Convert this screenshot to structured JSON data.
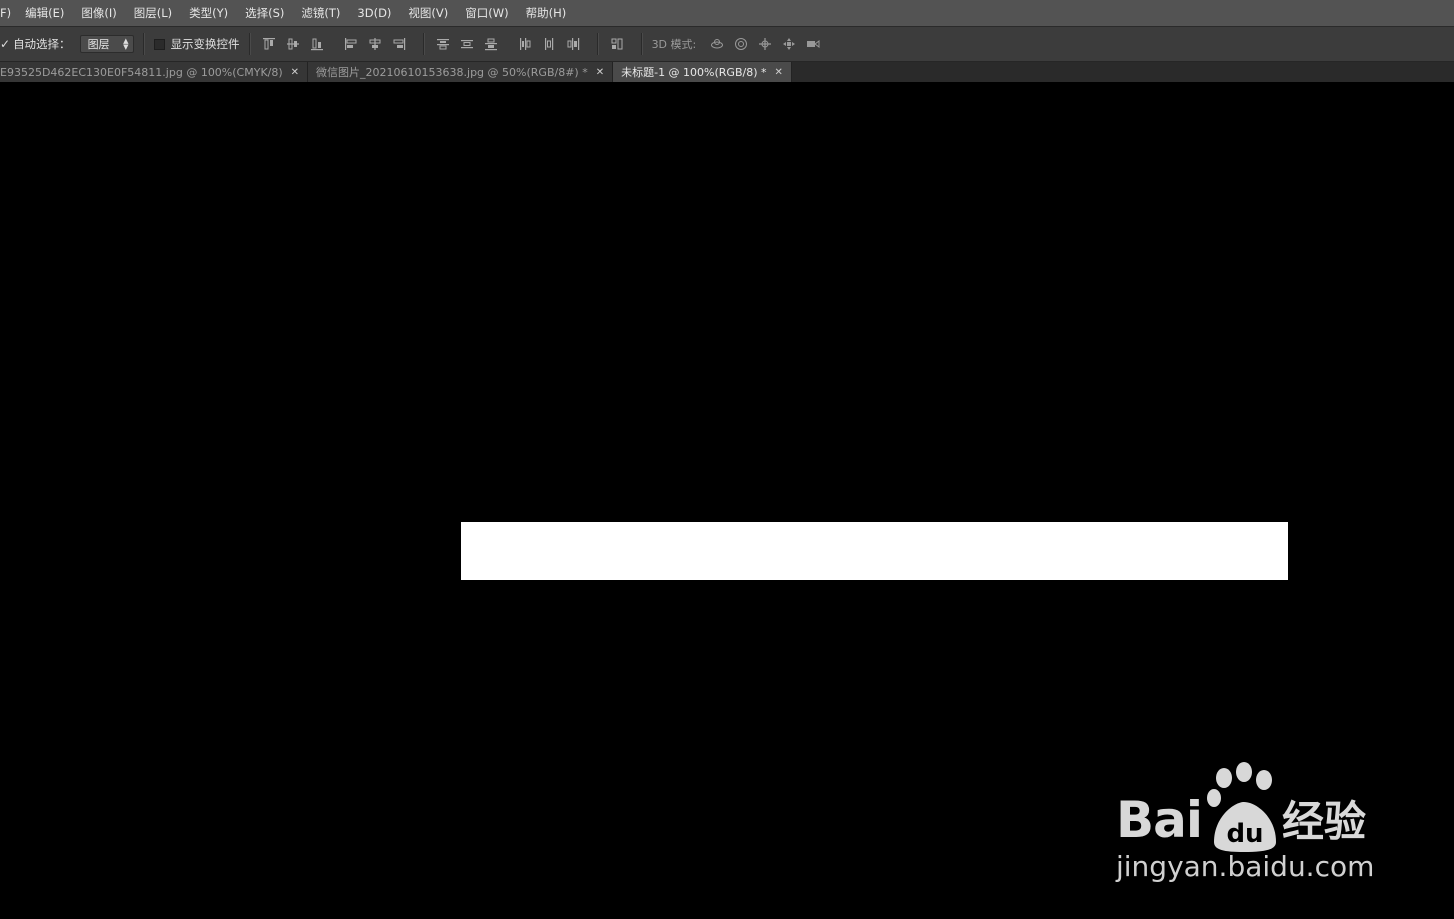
{
  "menubar": {
    "items": [
      "F)",
      "编辑(E)",
      "图像(I)",
      "图层(L)",
      "类型(Y)",
      "选择(S)",
      "滤镜(T)",
      "3D(D)",
      "视图(V)",
      "窗口(W)",
      "帮助(H)"
    ]
  },
  "options": {
    "auto_select_label": "自动选择：",
    "auto_select_value": "图层",
    "show_transform_label": "显示变换控件",
    "mode_label": "3D 模式:"
  },
  "tabs": [
    {
      "label": "E93525D462EC130E0F54811.jpg @ 100%(CMYK/8)",
      "active": false
    },
    {
      "label": "微信图片_20210610153638.jpg @ 50%(RGB/8#) *",
      "active": false
    },
    {
      "label": "未标题-1 @ 100%(RGB/8) *",
      "active": true
    }
  ],
  "watermark": {
    "brand": "Bai",
    "brand2": "du",
    "suffix": "经验",
    "url": "jingyan.baidu.com"
  },
  "colors": {
    "menubar_bg": "#535353",
    "optionsbar_bg": "#3c3c3c",
    "canvas_bg": "#000000",
    "shape_fill": "#ffffff"
  }
}
